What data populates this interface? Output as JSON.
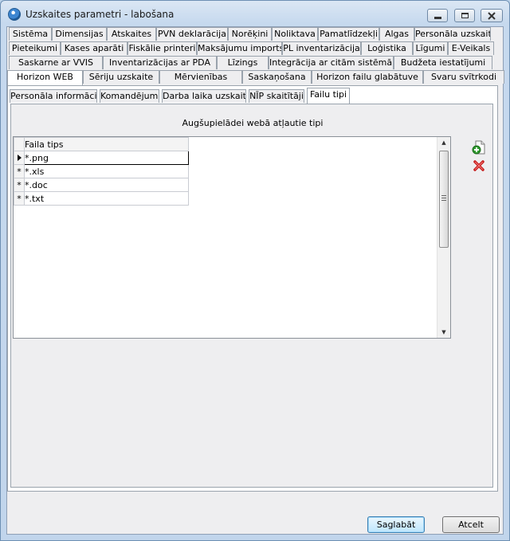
{
  "window": {
    "title": "Uzskaites parametri - labošana"
  },
  "tab_rows": [
    [
      {
        "label": "Sistēma",
        "w": 54
      },
      {
        "label": "Dimensijas",
        "w": 69
      },
      {
        "label": "Atskaites",
        "w": 62
      },
      {
        "label": "PVN deklarācija",
        "w": 90
      },
      {
        "label": "Norēķini",
        "w": 55
      },
      {
        "label": "Noliktava",
        "w": 58
      },
      {
        "label": "Pamatlīdzekļi",
        "w": 77
      },
      {
        "label": "Algas",
        "w": 44
      },
      {
        "label": "Personāla uzskaite",
        "w": 96
      }
    ],
    [
      {
        "label": "Pieteikumi",
        "w": 65
      },
      {
        "label": "Kases aparāti",
        "w": 84
      },
      {
        "label": "Fiskālie printeri",
        "w": 87
      },
      {
        "label": "Maksājumu imports",
        "w": 107
      },
      {
        "label": "PL inventarizācija",
        "w": 99
      },
      {
        "label": "Loģistika",
        "w": 65
      },
      {
        "label": "Līgumi",
        "w": 44
      },
      {
        "label": "E-Veikals",
        "w": 58
      }
    ],
    [
      {
        "label": "Saskarne ar VVIS",
        "w": 118
      },
      {
        "label": "Inventarizācijas ar PDA",
        "w": 143
      },
      {
        "label": "Līzings",
        "w": 65
      },
      {
        "label": "Integrācija ar citām sistēmām",
        "w": 157
      },
      {
        "label": "Budžeta iestatījumi",
        "w": 124
      }
    ],
    [
      {
        "label": "Horizon WEB",
        "w": 95
      },
      {
        "label": "Sēriju uzskaite",
        "w": 96
      },
      {
        "label": "Mērvienības",
        "w": 104
      },
      {
        "label": "Saskaņošana",
        "w": 87
      },
      {
        "label": "Horizon failu glabātuve",
        "w": 140
      },
      {
        "label": "Svaru svītrkodi",
        "w": 102
      }
    ]
  ],
  "selected_main_tab": "Horizon WEB",
  "sub_tabs": [
    {
      "label": "Personāla informācija"
    },
    {
      "label": "Komandējumi"
    },
    {
      "label": "Darba laika uzskaite"
    },
    {
      "label": "NĪP skaitītāji"
    },
    {
      "label": "Failu tipi"
    }
  ],
  "selected_sub_tab": "Failu tipi",
  "panel": {
    "caption": "Augšupielādei webā atļautie tipi",
    "grid": {
      "column_header": "Faila tips",
      "rows": [
        {
          "marker": "current",
          "value": "*.png"
        },
        {
          "marker": "*",
          "value": "*.xls"
        },
        {
          "marker": "*",
          "value": "*.doc"
        },
        {
          "marker": "*",
          "value": "*.txt"
        }
      ]
    },
    "actions": {
      "add_icon": "add-file-icon",
      "delete_icon": "delete-x-icon"
    }
  },
  "footer": {
    "save_label": "Saglabāt",
    "cancel_label": "Atcelt"
  }
}
